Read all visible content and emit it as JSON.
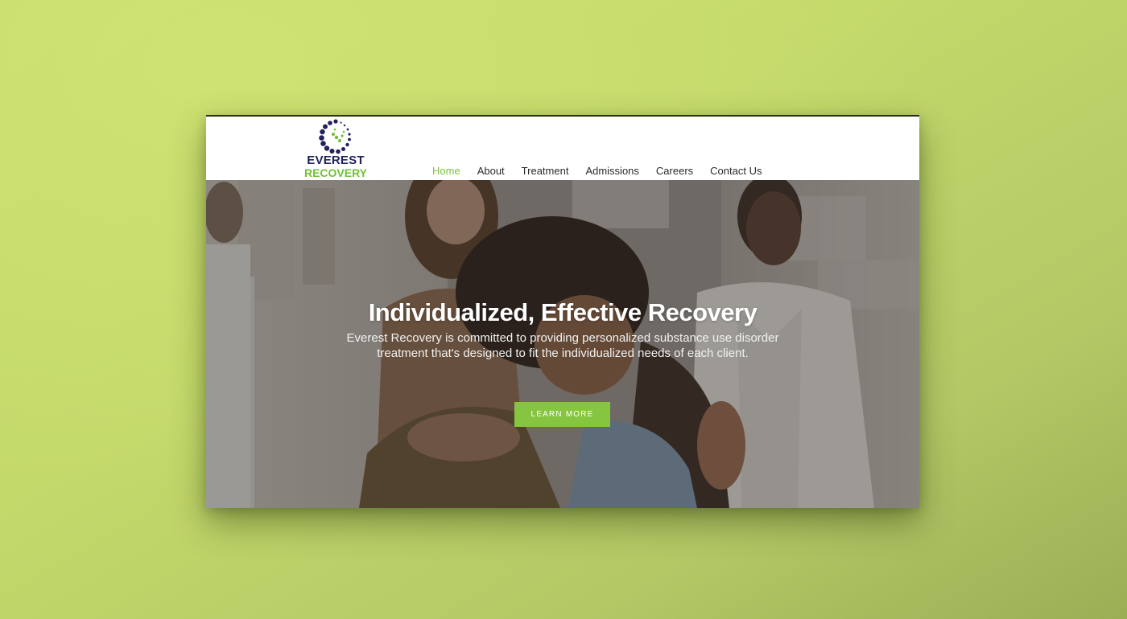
{
  "logo": {
    "line1": "EVEREST",
    "line2": "RECOVERY",
    "colors": {
      "navy": "#22205e",
      "green": "#6fc135"
    }
  },
  "nav": {
    "items": [
      {
        "label": "Home",
        "active": true
      },
      {
        "label": "About",
        "active": false
      },
      {
        "label": "Treatment",
        "active": false
      },
      {
        "label": "Admissions",
        "active": false
      },
      {
        "label": "Careers",
        "active": false
      },
      {
        "label": "Contact Us",
        "active": false
      }
    ]
  },
  "hero": {
    "title": "Individualized, Effective Recovery",
    "subtitle": "Everest Recovery is committed to providing personalized substance use disorder treatment that's designed to fit the individualized needs of each client.",
    "button_label": "LEARN MORE"
  },
  "colors": {
    "accent": "#86c540",
    "background": "#c3d96a",
    "nav_text": "#2a2a2a"
  }
}
